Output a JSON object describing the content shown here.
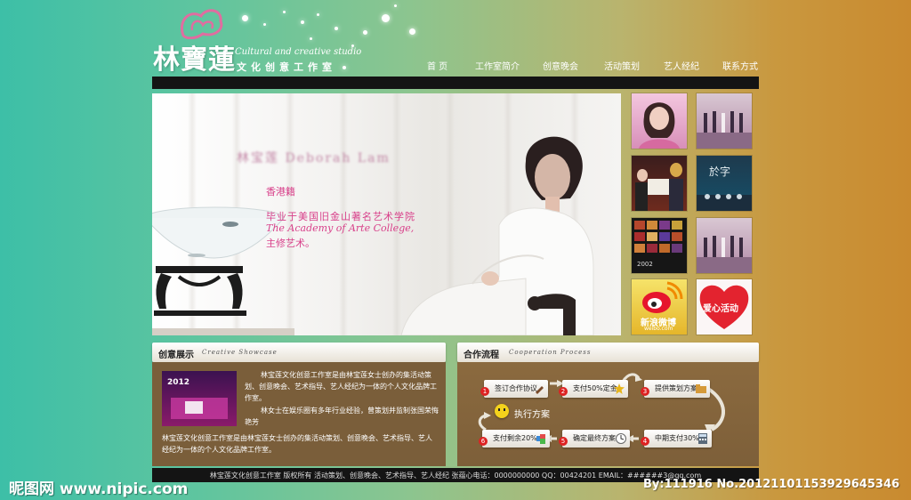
{
  "header": {
    "logo_title": "林寶蓮",
    "logo_subtitle_en": "Cultural and creative studio",
    "logo_subtitle_cn": "文化创意工作室"
  },
  "nav": {
    "items": [
      "首 页",
      "工作室简介",
      "创意晚会",
      "活动策划",
      "艺人经纪",
      "联系方式"
    ]
  },
  "hero": {
    "name": "林宝莲 Deborah Lam",
    "origin": "香港籍",
    "line1": "毕业于美国旧金山著名艺术学院",
    "line2": "The Academy of Arte College,",
    "line3": "主修艺术。"
  },
  "thumbnails": [
    {
      "icon": "portrait-photo"
    },
    {
      "icon": "stage-performance-photo"
    },
    {
      "icon": "award-ceremony-photo"
    },
    {
      "icon": "stage-show-photo"
    },
    {
      "icon": "photo-collage",
      "caption": "2002"
    },
    {
      "icon": "stage-performance-photo"
    },
    {
      "icon": "weibo-icon",
      "label": "新浪微博",
      "sublabel": "weibo.com"
    },
    {
      "icon": "heart-icon",
      "label": "爱心活动"
    }
  ],
  "showcase": {
    "title": "创意展示",
    "subtitle": "Creative Showcase",
    "image_caption": "2012",
    "para1": "林宝莲文化创意工作室是由林宝莲女士创办的集活动策划、创意晚会、艺术指导、艺人经纪为一体的个人文化品牌工作室。",
    "para2": "林女士在娱乐圈有多年行业经验，曾策划并监制张国荣悔艳芳",
    "para3": "林宝莲文化创意工作室是由林宝莲女士创办的集活动策划、创意晚会、艺术指导、艺人经纪为一体的个人文化品牌工作室。"
  },
  "process": {
    "title": "合作流程",
    "subtitle": "Cooperation Process",
    "steps": [
      {
        "num": "1",
        "label": "签订合作协议"
      },
      {
        "num": "2",
        "label": "支付50%定金"
      },
      {
        "num": "3",
        "label": "提供策划方案"
      },
      {
        "num": "4",
        "label": "中期支付30%"
      },
      {
        "num": "5",
        "label": "确定最终方案"
      },
      {
        "num": "6",
        "label": "支付剩余20%"
      }
    ],
    "execute_label": "执行方案"
  },
  "footer": {
    "text": "林宝莲文化创意工作室 版权所有  活动策划、创意晚会、艺术指导、艺人经纪 张蕴心电话：0000000000  QQ：00424201  EMAIL：######3@qq.com"
  },
  "watermark": {
    "left": "昵图网 www.nipic.com",
    "right": "By:111916  No.20121101153929645346"
  }
}
